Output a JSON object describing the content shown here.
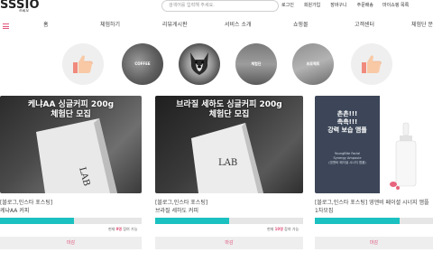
{
  "header": {
    "logo": "SSSIO",
    "logo_sub": "쓰씨오",
    "search_placeholder": "검색어를 입력해 주세요.",
    "links": [
      "로그인",
      "회원가입",
      "장바구니",
      "주문배송",
      "마이쇼핑 목록"
    ]
  },
  "nav": {
    "items": [
      "홈",
      "체험하기",
      "리뷰게시판",
      "서비스 소개",
      "쇼핑몰",
      "고객센터",
      "체험단 문"
    ]
  },
  "circles": [
    {
      "type": "icon",
      "icon": "thumbs-up-icon",
      "label": ""
    },
    {
      "type": "photo",
      "label": "COFFEE"
    },
    {
      "type": "photo",
      "label": ""
    },
    {
      "type": "photo",
      "label": "체험단"
    },
    {
      "type": "photo",
      "label": "프로젝트"
    },
    {
      "type": "icon",
      "icon": "thumbs-up-icon",
      "label": ""
    }
  ],
  "cards": [
    {
      "image_title_line1": "케냐AA 싱글커피 200g",
      "image_title_line2": "체험단 모집",
      "title_line1": "[블로그,인스타 포스팅]",
      "title_line2": "케냐AA 커피",
      "progress": 0.52,
      "meta_prefix": "현재 ",
      "meta_count": "9명",
      "meta_suffix": " 참여 가능",
      "button": "마감"
    },
    {
      "image_title_line1": "브라질 세하도 싱글커피 200g",
      "image_title_line2": "체험단 모집",
      "title_line1": "[블로그,인스타 포스팅]",
      "title_line2": "브라질 세하도 커피",
      "progress": 0.5,
      "meta_prefix": "현재 ",
      "meta_count": "10명",
      "meta_suffix": " 참여 가능",
      "button": "마감"
    },
    {
      "image_title_line1": "촉촉!!!",
      "image_title_line2": "강력 보습 앰플",
      "image_title_line0": "촌촌!!!",
      "image_small1": "YoungBite Facial",
      "image_small2": "Synergy Ampoule",
      "image_small3": "(영앤비 페이셜 시너지 앰플)",
      "title_line1": "[블로그,인스타 포스팅] 영앤비 페이셜 시너지 앰플",
      "title_line2": "1차모집",
      "progress": 0.72,
      "meta_prefix": "현재 ",
      "meta_count": "3명",
      "meta_suffix": " 참여 가능",
      "button": "마감"
    }
  ],
  "colors": {
    "accent": "#e0567e",
    "progress": "#1bc1c0"
  }
}
